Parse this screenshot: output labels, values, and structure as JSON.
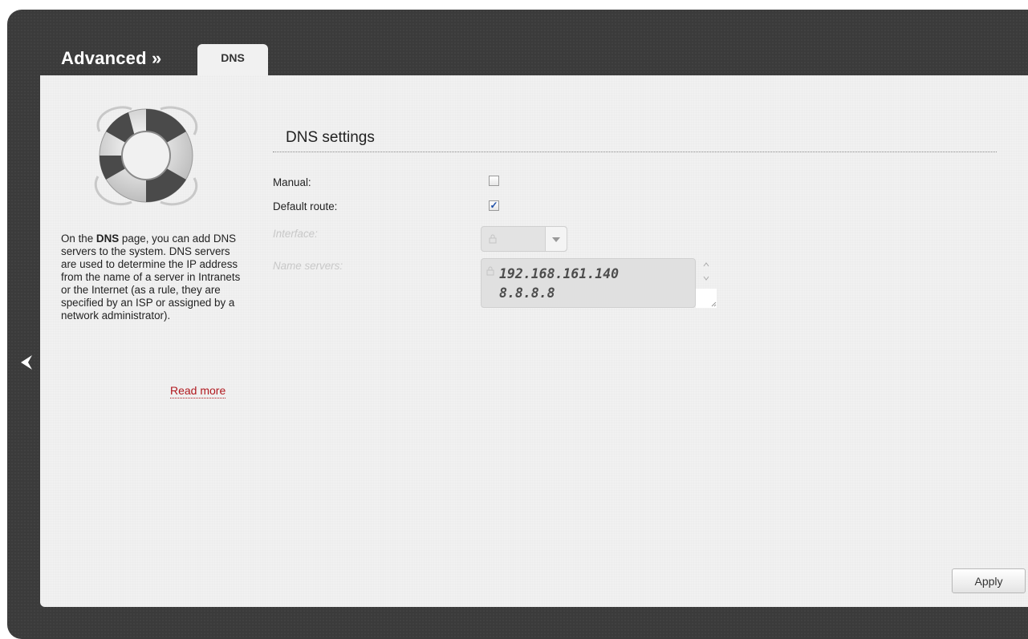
{
  "header": {
    "breadcrumb": "Advanced »",
    "active_tab": "DNS"
  },
  "sidebar": {
    "help_prefix": "On the ",
    "help_bold": "DNS",
    "help_rest": " page, you can add DNS servers to the system. DNS servers are used to determine the IP address from the name of a server in Intranets or the Internet (as a rule, they are specified by an ISP or assigned by a network administrator).",
    "read_more": "Read more"
  },
  "dns_settings": {
    "title": "DNS settings",
    "manual_label": "Manual:",
    "manual_checked": false,
    "default_route_label": "Default route:",
    "default_route_checked": true,
    "interface_label": "Interface:",
    "interface_value": "",
    "name_servers_label": "Name servers:",
    "name_servers": [
      "192.168.161.140",
      "8.8.8.8"
    ]
  },
  "buttons": {
    "apply": "Apply"
  },
  "icons": {
    "back": "chevron-left-icon",
    "logo": "lifebuoy-icon",
    "lock": "lock-icon"
  }
}
